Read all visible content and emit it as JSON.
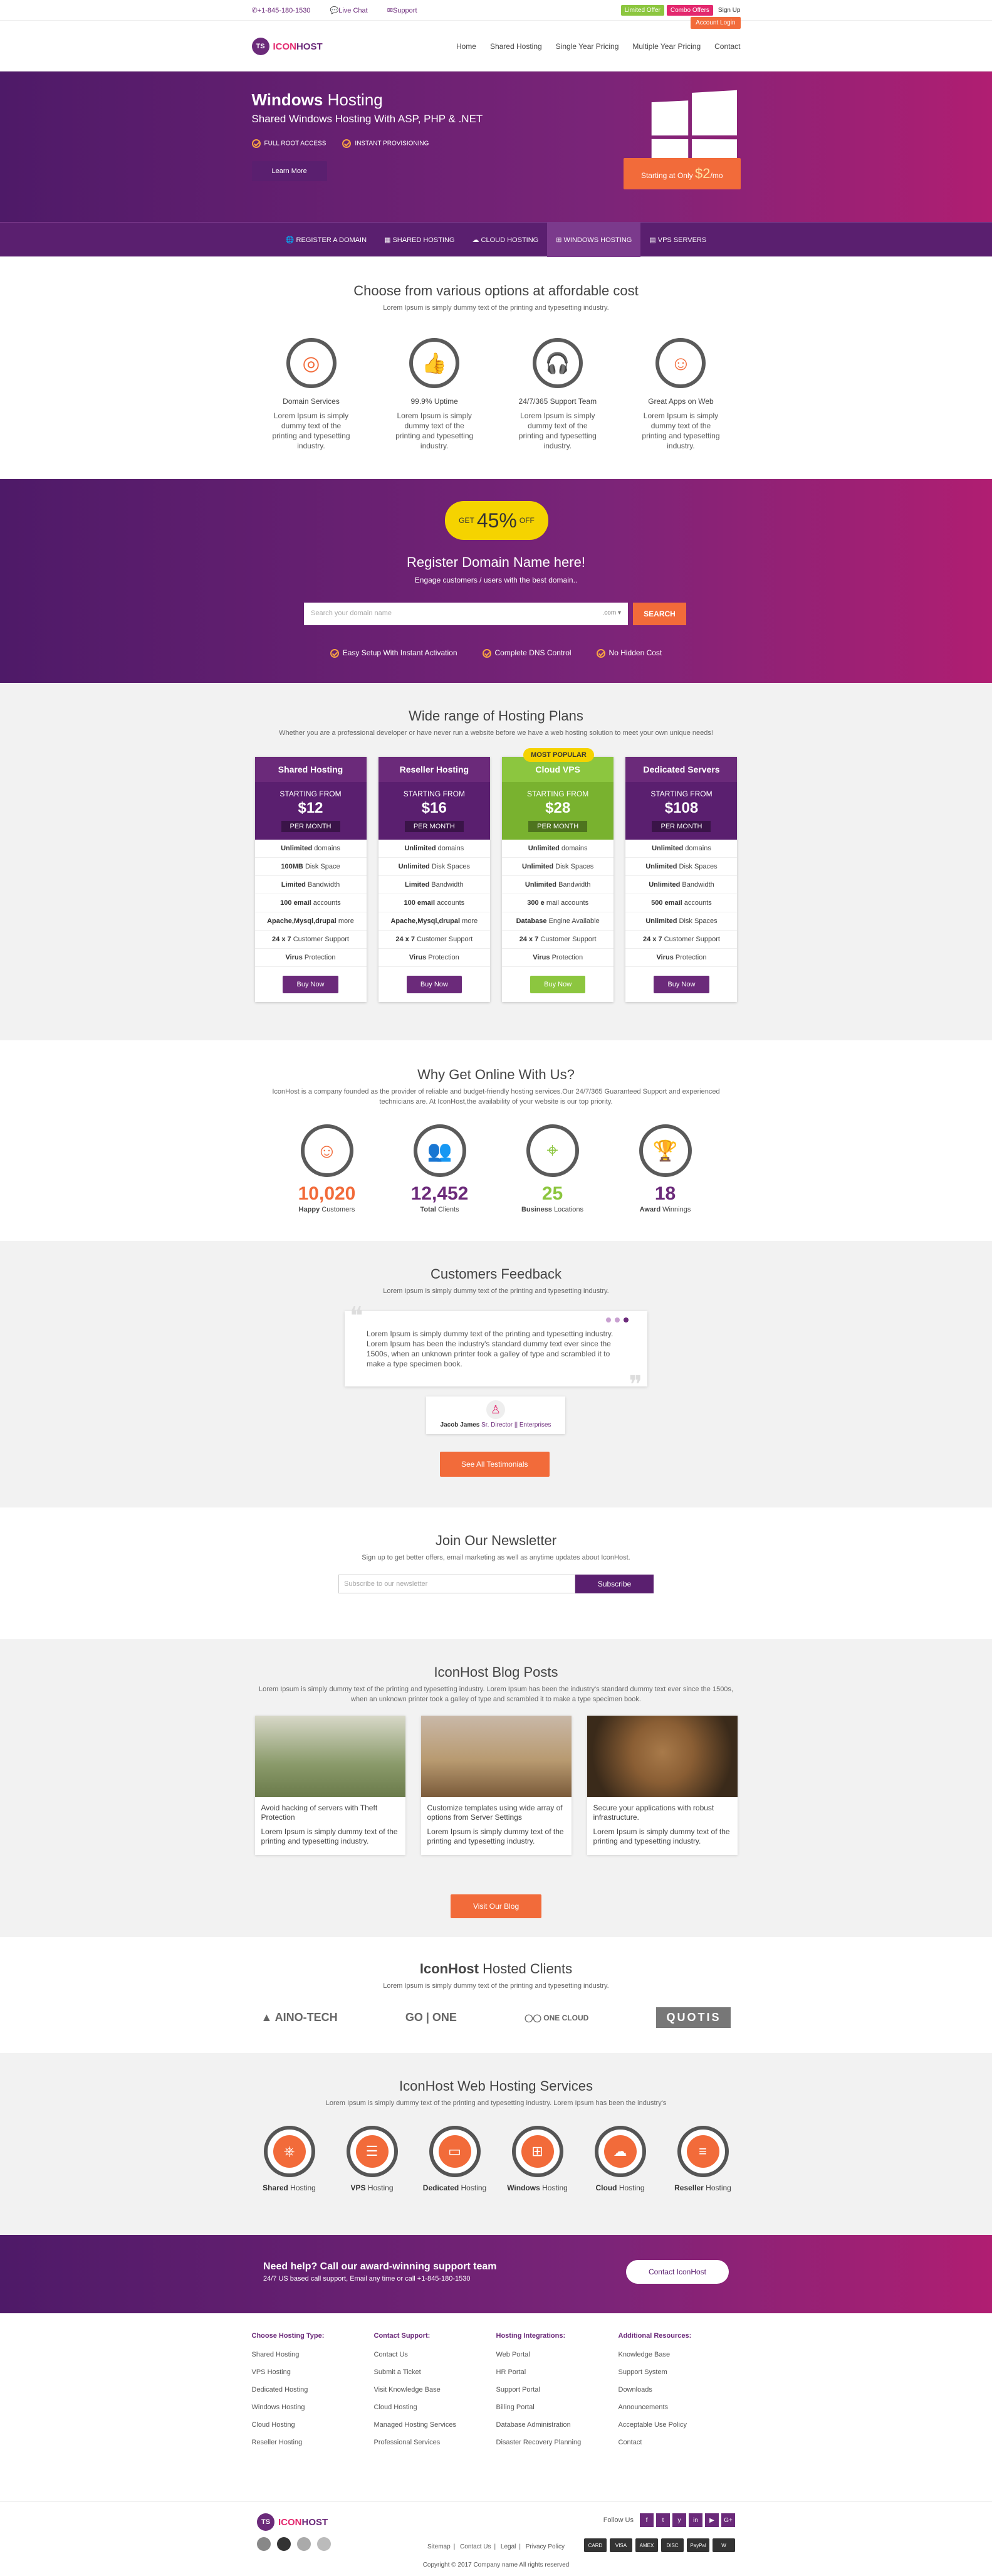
{
  "topbar": {
    "phone": "+1-845-180-1530",
    "chat": "Live Chat",
    "support": "Support",
    "limited": "Limited Offer",
    "combo": "Combo Offers",
    "signup": "Sign Up",
    "account": "Account Login"
  },
  "brand": {
    "ts": "TS",
    "icon": "ICON",
    "host": "HOST"
  },
  "nav": [
    "Home",
    "Shared Hosting",
    "Single Year Pricing",
    "Multiple Year Pricing",
    "Contact"
  ],
  "hero": {
    "title_bold": "Windows",
    "title_rest": " Hosting",
    "subtitle": "Shared Windows Hosting With ASP, PHP & .NET",
    "check1": "FULL ROOT ACCESS",
    "check2": "INSTANT PROVISIONING",
    "learn": "Learn More",
    "starting": "Starting at Only",
    "price": "$2",
    "per": "/mo"
  },
  "subnav": [
    "REGISTER A DOMAIN",
    "SHARED HOSTING",
    "CLOUD HOSTING",
    "WINDOWS HOSTING",
    "VPS SERVERS"
  ],
  "features": {
    "title": "Choose from various options at affordable cost",
    "sub": "Lorem Ipsum is simply dummy text of the printing and typesetting industry.",
    "items": [
      {
        "icon": "globe-icon",
        "glyph": "◎",
        "label": "Domain Services",
        "text": "Lorem Ipsum is simply dummy text of the printing and typesetting industry."
      },
      {
        "icon": "thumbs-up-icon",
        "glyph": "👍",
        "label": "99.9% Uptime",
        "text": "Lorem Ipsum is simply dummy text of the printing and typesetting industry."
      },
      {
        "icon": "headset-icon",
        "glyph": "🎧",
        "label": "24/7/365 Support Team",
        "text": "Lorem Ipsum is simply dummy text of the printing and typesetting industry."
      },
      {
        "icon": "smiley-icon",
        "glyph": "☺",
        "label": "Great Apps on Web",
        "text": "Lorem Ipsum is simply dummy text of the printing and typesetting industry."
      }
    ]
  },
  "domain": {
    "get": "GET",
    "pct": "45%",
    "off": "OFF",
    "title": "Register Domain Name here!",
    "sub": "Engage customers / users with the best domain..",
    "placeholder": "Search your domain name",
    "tld": ".com",
    "search": "SEARCH",
    "f1": "Easy Setup With Instant Activation",
    "f2": "Complete DNS Control",
    "f3": "No Hidden Cost"
  },
  "plans": {
    "title": "Wide range of Hosting Plans",
    "sub": "Whether you are a professional developer or have never run a website before we have a web hosting solution to meet your own unique needs!",
    "starting": "STARTING FROM",
    "per": "PER MONTH",
    "buy": "Buy Now",
    "popular": "MOST POPULAR",
    "items": [
      {
        "name": "Shared Hosting",
        "price": "$12",
        "f": [
          [
            "Unlimited",
            "domains"
          ],
          [
            "100MB",
            "Disk Space"
          ],
          [
            "Limited",
            "Bandwidth"
          ],
          [
            "100 email",
            "accounts"
          ],
          [
            "Apache,Mysql,drupal",
            "more"
          ],
          [
            "24 x 7",
            "Customer Support"
          ],
          [
            "Virus",
            "Protection"
          ]
        ]
      },
      {
        "name": "Reseller Hosting",
        "price": "$16",
        "f": [
          [
            "Unlimited",
            "domains"
          ],
          [
            "Unlimited",
            "Disk Spaces"
          ],
          [
            "Limited",
            "Bandwidth"
          ],
          [
            "100 email",
            "accounts"
          ],
          [
            "Apache,Mysql,drupal",
            "more"
          ],
          [
            "24 x 7",
            "Customer Support"
          ],
          [
            "Virus",
            "Protection"
          ]
        ]
      },
      {
        "name": "Cloud VPS",
        "price": "$28",
        "f": [
          [
            "Unlimited",
            "domains"
          ],
          [
            "Unlimited",
            "Disk Spaces"
          ],
          [
            "Unlimited",
            "Bandwidth"
          ],
          [
            "300 e",
            "mail accounts"
          ],
          [
            "Database",
            "Engine Available"
          ],
          [
            "24 x 7",
            "Customer Support"
          ],
          [
            "Virus",
            "Protection"
          ]
        ]
      },
      {
        "name": "Dedicated Servers",
        "price": "$108",
        "f": [
          [
            "Unlimited",
            "domains"
          ],
          [
            "Unlimited",
            "Disk Spaces"
          ],
          [
            "Unlimited",
            "Bandwidth"
          ],
          [
            "500 email",
            "accounts"
          ],
          [
            "Unlimited",
            "Disk Spaces"
          ],
          [
            "24 x 7",
            "Customer Support"
          ],
          [
            "Virus",
            "Protection"
          ]
        ]
      }
    ]
  },
  "stats": {
    "title": "Why Get Online With Us?",
    "sub": "IconHost is a company founded as the provider of reliable and budget-friendly hosting services.Our 24/7/365 Guaranteed Support and experienced technicians are. At IconHost,the availability of your website is our top priority.",
    "items": [
      {
        "icon": "smiley-icon",
        "glyph": "☺",
        "num": "10,020",
        "b": "Happy",
        "l": "Customers",
        "color": "#f26b3a"
      },
      {
        "icon": "users-icon",
        "glyph": "👥",
        "num": "12,452",
        "b": "Total",
        "l": "Clients",
        "color": "#6b2a7a"
      },
      {
        "icon": "location-icon",
        "glyph": "⌖",
        "num": "25",
        "b": "Business",
        "l": "Locations",
        "color": "#8cc63f"
      },
      {
        "icon": "trophy-icon",
        "glyph": "🏆",
        "num": "18",
        "b": "Award",
        "l": "Winnings",
        "color": "#6b2a7a"
      }
    ]
  },
  "testimonial": {
    "title": "Customers Feedback",
    "sub": "Lorem Ipsum is simply dummy text of the printing and typesetting industry.",
    "text": "Lorem Ipsum is simply dummy text of the printing and typesetting industry. Lorem Ipsum has been the industry's standard dummy text ever since the 1500s, when an unknown printer took a galley of type and scrambled it to make a type specimen book.",
    "name": "Jacob James",
    "role": "Sr. Director || Enterprises",
    "see": "See All Testimonials"
  },
  "newsletter": {
    "title": "Join Our Newsletter",
    "sub": "Sign up to get better offers, email marketing as well as anytime updates about IconHost.",
    "placeholder": "Subscribe to our newsletter",
    "btn": "Subscribe"
  },
  "blog": {
    "title": "IconHost Blog Posts",
    "sub": "Lorem Ipsum is simply dummy text of the printing and typesetting industry. Lorem Ipsum has been the industry's standard dummy text ever since the 1500s, when an unknown printer took a galley of type and scrambled it to make a type specimen book.",
    "posts": [
      {
        "h": "Avoid hacking of servers with Theft Protection",
        "t": "Lorem Ipsum is simply dummy text of the printing and typesetting industry."
      },
      {
        "h": "Customize templates using wide array of options from Server Settings",
        "t": "Lorem Ipsum is simply dummy text of the printing and typesetting industry."
      },
      {
        "h": "Secure your applications with robust infrastructure.",
        "t": "Lorem Ipsum is simply dummy text of the printing and typesetting industry."
      }
    ],
    "visit": "Visit Our Blog"
  },
  "clients": {
    "title_bold": "IconHost",
    "title_rest": " Hosted Clients",
    "sub": "Lorem Ipsum is simply dummy text of the printing and typesetting industry.",
    "logos": [
      "AINO-TECH",
      "GO | ONE",
      "ONE CLOUD",
      "QUOTIS"
    ]
  },
  "services": {
    "title": "IconHost Web Hosting Services",
    "sub": "Lorem Ipsum is simply dummy text of the printing and typesetting industry. Lorem Ipsum has been the industry's",
    "items": [
      {
        "icon": "network-icon",
        "glyph": "⎈",
        "b": "Shared",
        "l": "Hosting"
      },
      {
        "icon": "server-icon",
        "glyph": "☰",
        "b": "VPS",
        "l": "Hosting"
      },
      {
        "icon": "monitor-icon",
        "glyph": "▭",
        "b": "Dedicated",
        "l": "Hosting"
      },
      {
        "icon": "windows-icon",
        "glyph": "⊞",
        "b": "Windows",
        "l": "Hosting"
      },
      {
        "icon": "cloud-icon",
        "glyph": "☁",
        "b": "Cloud",
        "l": "Hosting"
      },
      {
        "icon": "reseller-icon",
        "glyph": "≡",
        "b": "Reseller",
        "l": "Hosting"
      }
    ]
  },
  "cta": {
    "title": "Need help? Call our award-winning support team",
    "sub": "24/7 US based call support, Email any time or call +1-845-180-1530",
    "btn": "Contact IconHost"
  },
  "footer": {
    "cols": [
      {
        "h": "Choose Hosting Type:",
        "items": [
          "Shared Hosting",
          "VPS Hosting",
          "Dedicated Hosting",
          "Windows Hosting",
          "Cloud Hosting",
          "Reseller Hosting"
        ]
      },
      {
        "h": "Contact Support:",
        "items": [
          "Contact Us",
          "Submit a Ticket",
          "Visit Knowledge Base",
          "Cloud Hosting",
          "Managed Hosting Services",
          "Professional Services"
        ]
      },
      {
        "h": "Hosting Integrations:",
        "items": [
          "Web Portal",
          "HR Portal",
          "Support Portal",
          "Billing Portal",
          "Database Administration",
          "Disaster Recovery Planning"
        ]
      },
      {
        "h": "Additional Resources:",
        "items": [
          "Knowledge Base",
          "Support System",
          "Downloads",
          "Announcements",
          "Acceptable Use Policy",
          "Contact"
        ]
      }
    ],
    "follow": "Follow Us",
    "social": [
      "f",
      "t",
      "y",
      "in",
      "▶",
      "G+"
    ],
    "cards": [
      "CARD",
      "VISA",
      "AMEX",
      "DISC",
      "PayPal",
      "W"
    ],
    "links": [
      "Sitemap",
      "Contact Us",
      "Legal",
      "Privacy Policy"
    ],
    "copy": "Copyright © 2017 Company name All rights reserved"
  },
  "colors": {
    "purple": "#6b2a7a",
    "orange": "#f26b3a",
    "green": "#8cc63f",
    "yellow": "#f5d300"
  }
}
